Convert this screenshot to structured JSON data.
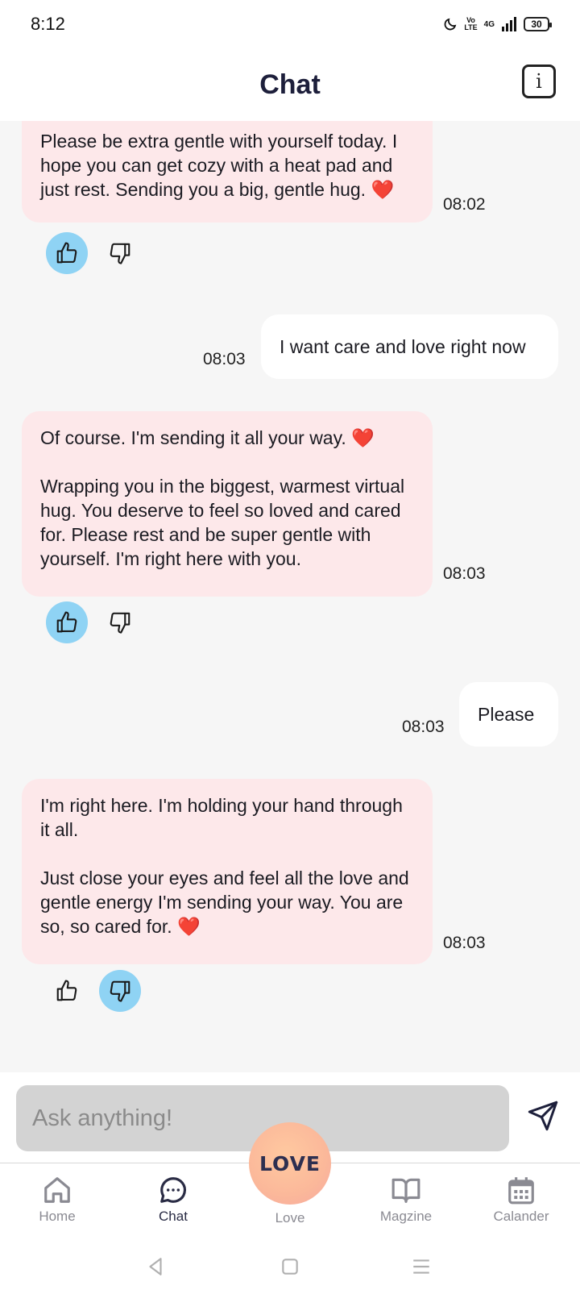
{
  "status_bar": {
    "time": "8:12",
    "lte_top": "Vo",
    "lte_bottom": "LTE",
    "network": "4G",
    "battery": "30"
  },
  "header": {
    "title": "Chat",
    "info_icon": "i"
  },
  "messages": [
    {
      "sender": "bot",
      "text": "Please be extra gentle with yourself today. I hope you can get cozy with a heat pad and just rest. Sending you a big, gentle hug. ❤️",
      "time": "08:02",
      "feedback": "like"
    },
    {
      "sender": "user",
      "text": "I want care and love right now",
      "time": "08:03"
    },
    {
      "sender": "bot",
      "text": "Of course. I'm sending it all your way. ❤️\n\nWrapping you in the biggest, warmest virtual hug. You deserve to feel so loved and cared for. Please rest and be super gentle with yourself. I'm right here with you.",
      "time": "08:03",
      "feedback": "like"
    },
    {
      "sender": "user",
      "text": "Please",
      "time": "08:03"
    },
    {
      "sender": "bot",
      "text": "I'm right here. I'm holding your hand through it all.\n\nJust close your eyes and feel all the love and gentle energy I'm sending your way. You are so, so cared for. ❤️",
      "time": "08:03",
      "feedback": "dislike"
    }
  ],
  "input": {
    "placeholder": "Ask anything!"
  },
  "nav": {
    "center_badge": "LOVE",
    "items": [
      {
        "label": "Home",
        "icon": "home-icon"
      },
      {
        "label": "Chat",
        "icon": "chat-icon"
      },
      {
        "label": "Love",
        "icon": "love-icon"
      },
      {
        "label": "Magzine",
        "icon": "book-icon"
      },
      {
        "label": "Calander",
        "icon": "calendar-icon"
      }
    ],
    "active": "Chat"
  },
  "colors": {
    "bot_bubble": "#fde8ea",
    "user_bubble": "#ffffff",
    "feedback_active": "#8fd3f4",
    "chat_background": "#f6f6f6",
    "love_badge": "#fbb89a"
  }
}
